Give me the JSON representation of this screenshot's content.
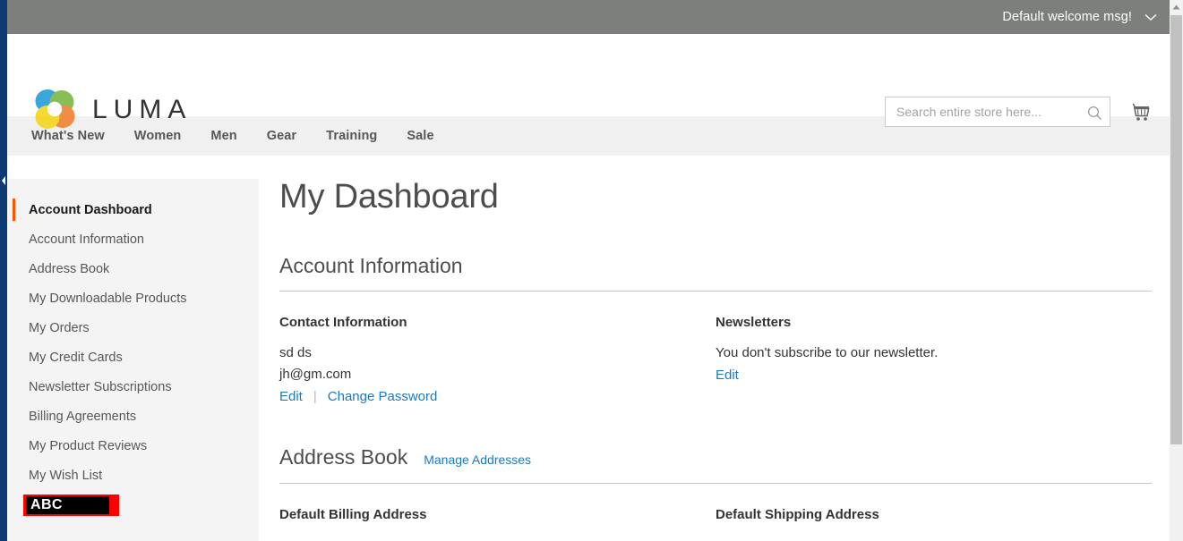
{
  "topbar": {
    "welcome_message": "Default welcome msg!",
    "caret_icon": "chevron-down-icon",
    "background_color": "#7d7f7d"
  },
  "header": {
    "logo_text": "LUMA",
    "logo_icon": "luma-logo-icon",
    "search": {
      "placeholder": "Search entire store here...",
      "value": "",
      "icon": "search-icon"
    },
    "cart": {
      "icon": "shopping-cart-icon"
    }
  },
  "nav": {
    "items": [
      {
        "label": "What's New"
      },
      {
        "label": "Women"
      },
      {
        "label": "Men"
      },
      {
        "label": "Gear"
      },
      {
        "label": "Training"
      },
      {
        "label": "Sale"
      }
    ]
  },
  "sidebar": {
    "items": [
      {
        "label": "Account Dashboard",
        "current": true
      },
      {
        "label": "Account Information",
        "current": false
      },
      {
        "label": "Address Book",
        "current": false
      },
      {
        "label": "My Downloadable Products",
        "current": false
      },
      {
        "label": "My Orders",
        "current": false
      },
      {
        "label": "My Credit Cards",
        "current": false
      },
      {
        "label": "Newsletter Subscriptions",
        "current": false
      },
      {
        "label": "Billing Agreements",
        "current": false
      },
      {
        "label": "My Product Reviews",
        "current": false
      },
      {
        "label": "My Wish List",
        "current": false
      }
    ],
    "marked_item": {
      "label": "ABC",
      "outer_color": "#ff0000",
      "inner_color": "#000000",
      "text_color": "#ffffff"
    },
    "accent_color": "#ff5501",
    "background_color": "#f4f4f4"
  },
  "main": {
    "page_title": "My Dashboard",
    "account_information": {
      "title": "Account Information",
      "contact": {
        "heading": "Contact Information",
        "name": "sd ds",
        "email": "jh@gm.com",
        "edit_label": "Edit",
        "separator": "|",
        "change_password_label": "Change Password"
      },
      "newsletters": {
        "heading": "Newsletters",
        "status": "You don't subscribe to our newsletter.",
        "edit_label": "Edit"
      }
    },
    "address_book": {
      "title": "Address Book",
      "manage_link": "Manage Addresses",
      "default_billing_heading": "Default Billing Address",
      "default_shipping_heading": "Default Shipping Address"
    },
    "link_color": "#1979c3"
  },
  "scrollbar": {
    "up_arrow_icon": "scroll-up-arrow-icon",
    "thumb": "vertical-scroll-thumb"
  },
  "left_rail": {
    "collapse_icon": "collapse-left-arrow-icon",
    "color": "#0d3a72"
  }
}
